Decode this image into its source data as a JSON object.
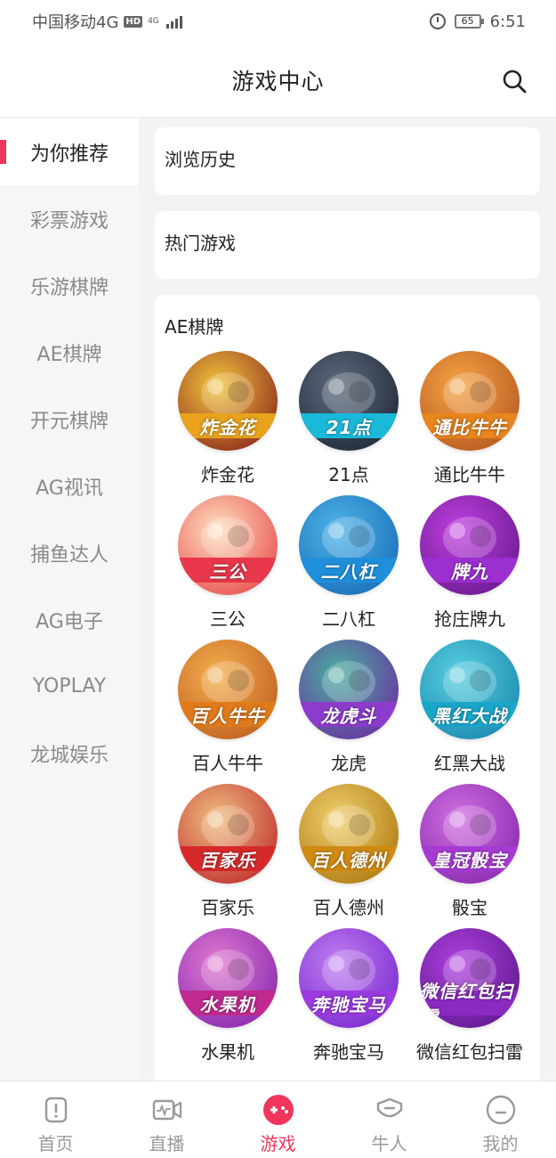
{
  "status_bar": {
    "carrier": "中国移动4G",
    "hd": "HD",
    "net": "4G",
    "battery": "65",
    "time": "6:51"
  },
  "header": {
    "title": "游戏中心",
    "search_icon": "search-icon"
  },
  "sidebar": {
    "items": [
      {
        "label": "为你推荐",
        "active": true
      },
      {
        "label": "彩票游戏",
        "active": false
      },
      {
        "label": "乐游棋牌",
        "active": false
      },
      {
        "label": "AE棋牌",
        "active": false
      },
      {
        "label": "开元棋牌",
        "active": false
      },
      {
        "label": "AG视讯",
        "active": false
      },
      {
        "label": "捕鱼达人",
        "active": false
      },
      {
        "label": "AG电子",
        "active": false
      },
      {
        "label": "YOPLAY",
        "active": false
      },
      {
        "label": "龙城娱乐",
        "active": false
      }
    ]
  },
  "sections": {
    "history": {
      "title": "浏览历史"
    },
    "hot": {
      "title": "热门游戏"
    },
    "ae": {
      "title": "AE棋牌",
      "games": [
        {
          "label": "炸金花",
          "banner": "炸金花",
          "colors": [
            "#f2c53d",
            "#8e2c1c"
          ],
          "banner_color": "#e8a21c"
        },
        {
          "label": "21点",
          "banner": "21点",
          "colors": [
            "#5f6b7d",
            "#1f2a38"
          ],
          "banner_color": "#1ab8d9"
        },
        {
          "label": "通比牛牛",
          "banner": "通比牛牛",
          "colors": [
            "#f4a445",
            "#b85a20"
          ],
          "banner_color": "#e8851d"
        },
        {
          "label": "三公",
          "banner": "三公",
          "colors": [
            "#ffe0c0",
            "#e85050"
          ],
          "banner_color": "#e8364a"
        },
        {
          "label": "二八杠",
          "banner": "二八杠",
          "colors": [
            "#4fb4e8",
            "#1a6fb8"
          ],
          "banner_color": "#1f8fdc"
        },
        {
          "label": "抢庄牌九",
          "banner": "牌九",
          "colors": [
            "#c040e0",
            "#6a1a90"
          ],
          "banner_color": "#9c2fd0"
        },
        {
          "label": "百人牛牛",
          "banner": "百人牛牛",
          "colors": [
            "#f4b050",
            "#c06020"
          ],
          "banner_color": "#e07a1a"
        },
        {
          "label": "龙虎",
          "banner": "龙虎斗",
          "colors": [
            "#4ab0a0",
            "#6a30a0"
          ],
          "banner_color": "#8c3ccc"
        },
        {
          "label": "红黑大战",
          "banner": "黑红大战",
          "colors": [
            "#5ad0e0",
            "#1a8ab0"
          ],
          "banner_color": "#19a6c9"
        },
        {
          "label": "百家乐",
          "banner": "百家乐",
          "colors": [
            "#f0c080",
            "#c03030"
          ],
          "banner_color": "#d62a2a"
        },
        {
          "label": "百人德州",
          "banner": "百人德州",
          "colors": [
            "#f0d070",
            "#b07a10"
          ],
          "banner_color": "#cf8a12"
        },
        {
          "label": "骰宝",
          "banner": "皇冠骰宝",
          "colors": [
            "#d070e0",
            "#8a2ab0"
          ],
          "banner_color": "#a83ad4"
        },
        {
          "label": "水果机",
          "banner": "水果机",
          "colors": [
            "#e07ad0",
            "#8a2ab0"
          ],
          "banner_color": "#c02a90"
        },
        {
          "label": "奔驰宝马",
          "banner": "奔驰宝马",
          "colors": [
            "#c080f0",
            "#7a2ad0"
          ],
          "banner_color": "#9a3ae0"
        },
        {
          "label": "微信红包扫雷",
          "banner": "微信红包扫雷",
          "colors": [
            "#b040e0",
            "#601a90"
          ],
          "banner_color": "#8a2ac0"
        }
      ]
    }
  },
  "bottom_nav": {
    "items": [
      {
        "label": "首页",
        "icon": "home-icon",
        "active": false
      },
      {
        "label": "直播",
        "icon": "live-icon",
        "active": false
      },
      {
        "label": "游戏",
        "icon": "gamepad-icon",
        "active": true
      },
      {
        "label": "牛人",
        "icon": "expert-icon",
        "active": false
      },
      {
        "label": "我的",
        "icon": "profile-icon",
        "active": false
      }
    ]
  },
  "colors": {
    "accent": "#f0365c",
    "inactive": "#9a9a9a"
  }
}
